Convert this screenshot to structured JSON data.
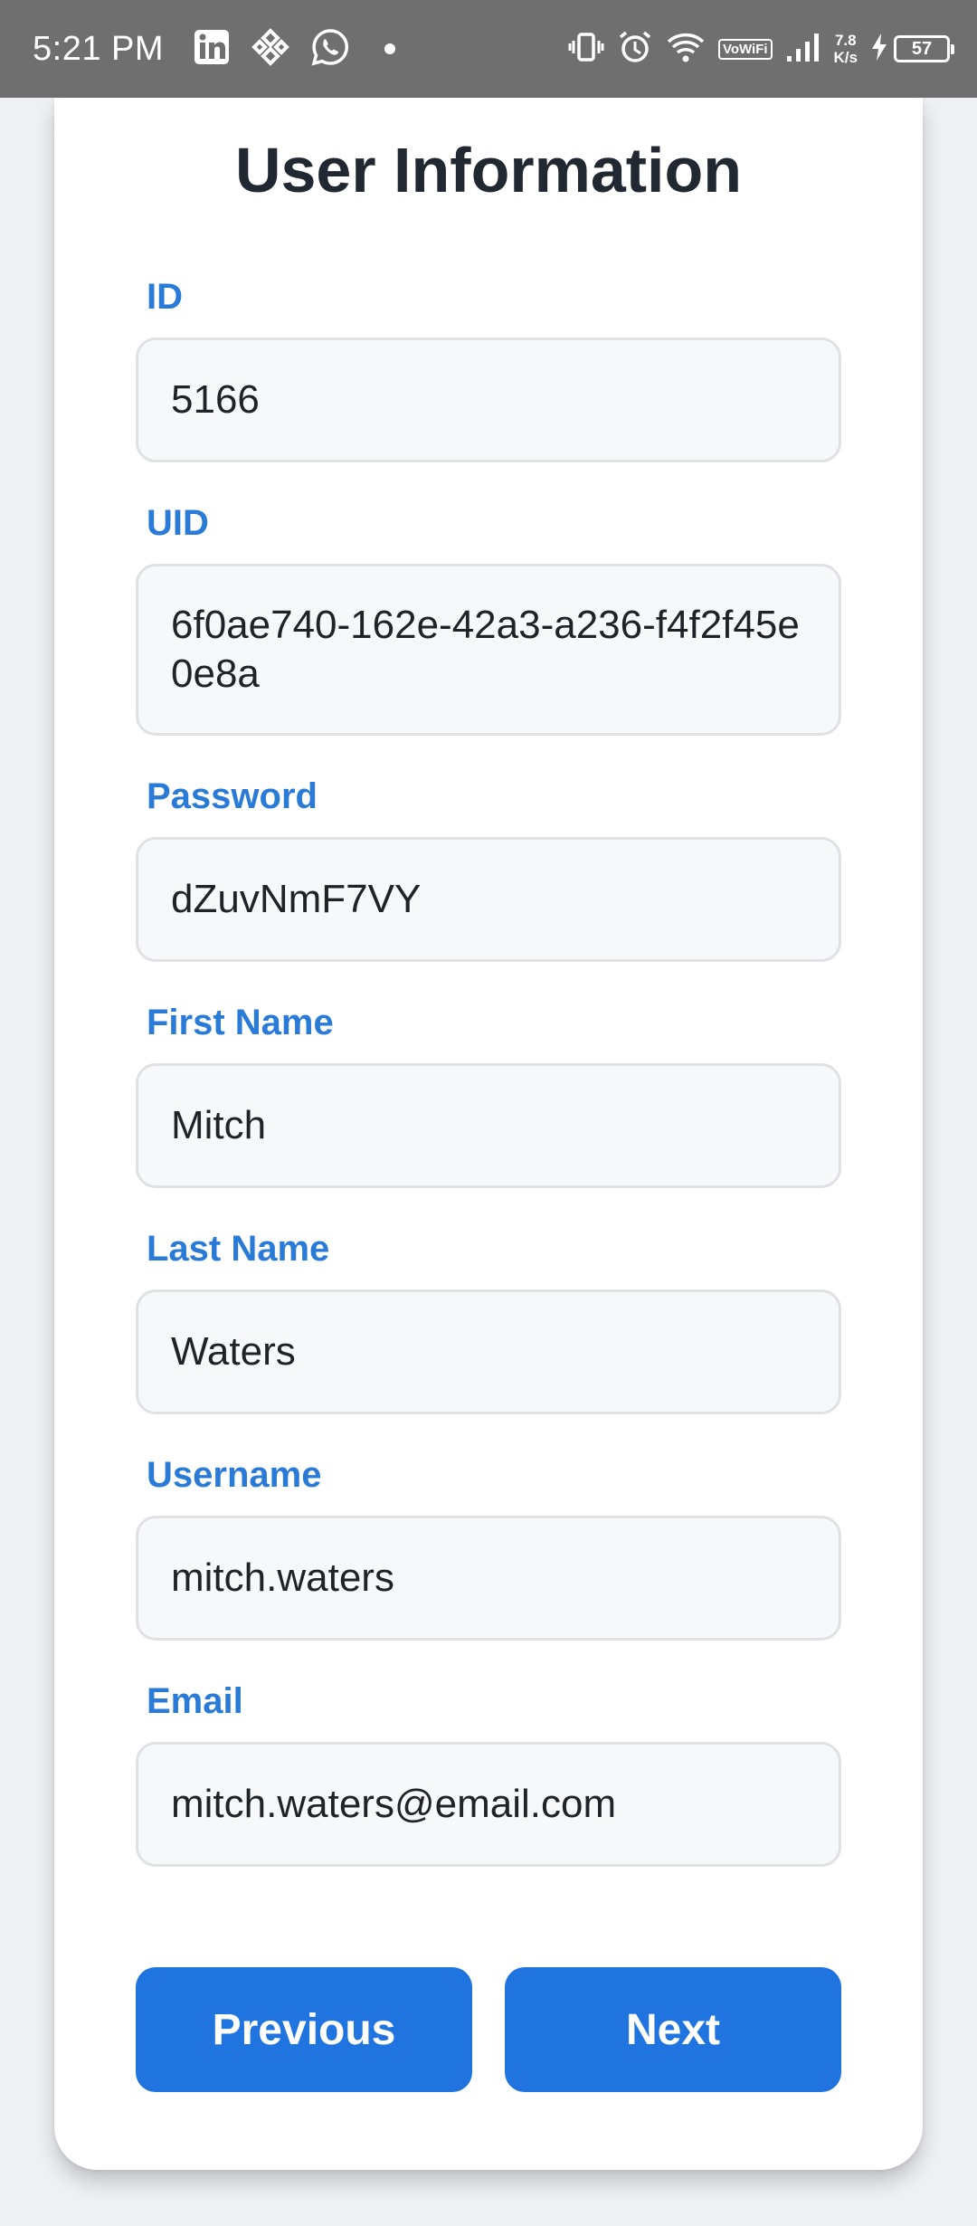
{
  "status_bar": {
    "time": "5:21 PM",
    "speed_value": "7.8",
    "speed_unit": "K/s",
    "vowifi": "VoWiFi",
    "battery": "57",
    "icons": [
      "linkedin-icon",
      "binance-icon",
      "whatsapp-icon",
      "vibrate-icon",
      "alarm-icon",
      "wifi-icon",
      "signal-icon",
      "charging-icon"
    ]
  },
  "form": {
    "title": "User Information",
    "fields": [
      {
        "label": "ID",
        "value": "5166"
      },
      {
        "label": "UID",
        "value": "6f0ae740-162e-42a3-a236-f4f2f45e0e8a"
      },
      {
        "label": "Password",
        "value": "dZuvNmF7VY"
      },
      {
        "label": "First Name",
        "value": "Mitch"
      },
      {
        "label": "Last Name",
        "value": "Waters"
      },
      {
        "label": "Username",
        "value": "mitch.waters"
      },
      {
        "label": "Email",
        "value": "mitch.waters@email.com"
      }
    ]
  },
  "buttons": {
    "previous": "Previous",
    "next": "Next"
  },
  "colors": {
    "accent": "#1f74e0",
    "label": "#2a7ad8",
    "status_bar": "#6f6f6f"
  }
}
